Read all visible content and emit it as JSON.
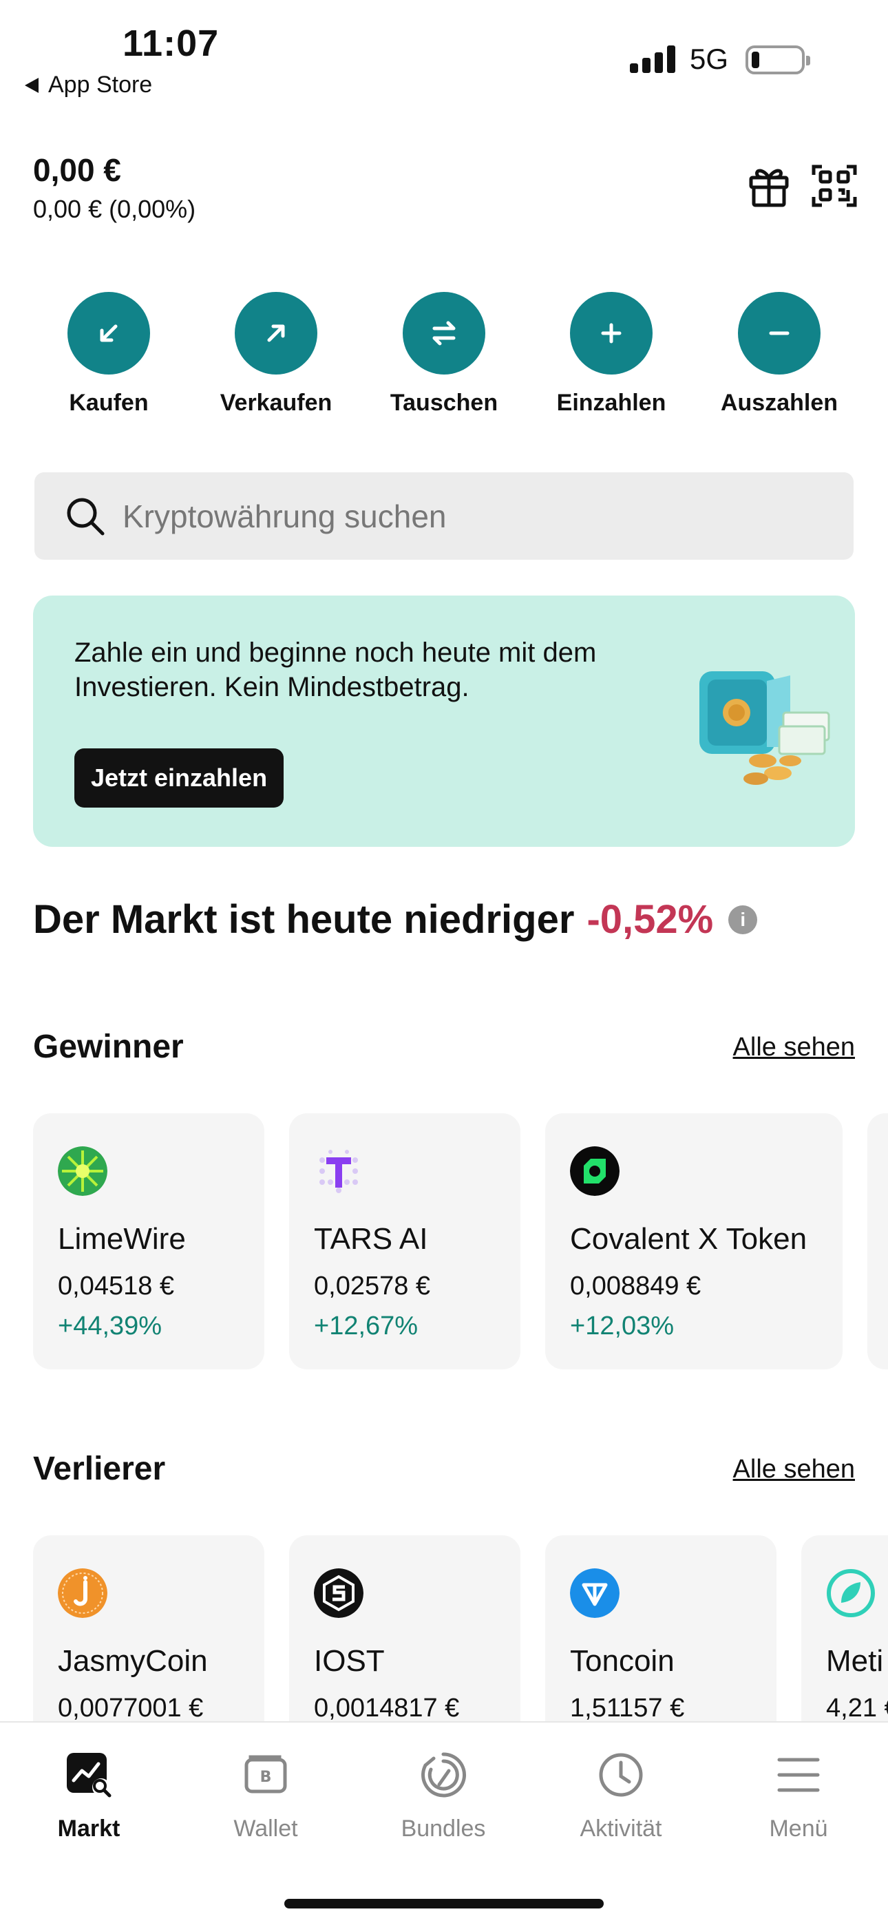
{
  "status_bar": {
    "time": "11:07",
    "back_label": "App Store",
    "network": "5G",
    "battery_level": 0.15
  },
  "portfolio": {
    "balance": "0,00 €",
    "change": "0,00 € (0,00%)"
  },
  "actions": [
    {
      "label": "Kaufen",
      "icon": "arrow-down-left-icon"
    },
    {
      "label": "Verkaufen",
      "icon": "arrow-up-right-icon"
    },
    {
      "label": "Tauschen",
      "icon": "swap-icon"
    },
    {
      "label": "Einzahlen",
      "icon": "plus-icon"
    },
    {
      "label": "Auszahlen",
      "icon": "minus-icon"
    }
  ],
  "search": {
    "placeholder": "Kryptowährung suchen"
  },
  "promo": {
    "text": "Zahle ein und beginne noch heute mit dem Investieren. Kein Mindestbetrag.",
    "button_label": "Jetzt einzahlen"
  },
  "market": {
    "headline": "Der Markt ist heute niedriger",
    "change": "-0,52%",
    "info_icon": "i"
  },
  "gainers": {
    "title": "Gewinner",
    "see_all": "Alle sehen",
    "items": [
      {
        "name": "LimeWire",
        "price": "0,04518 €",
        "change": "+44,39%"
      },
      {
        "name": "TARS AI",
        "price": "0,02578 €",
        "change": "+12,67%"
      },
      {
        "name": "Covalent X Token",
        "price": "0,008849 €",
        "change": "+12,03%"
      }
    ]
  },
  "losers": {
    "title": "Verlierer",
    "see_all": "Alle sehen",
    "items": [
      {
        "name": "JasmyCoin",
        "price": "0,0077001 €"
      },
      {
        "name": "IOST",
        "price": "0,0014817 €"
      },
      {
        "name": "Toncoin",
        "price": "1,51157 €"
      },
      {
        "name": "Meti",
        "price": "4,21 €"
      }
    ]
  },
  "tabbar": [
    {
      "label": "Markt",
      "icon": "market-chart-icon",
      "active": true
    },
    {
      "label": "Wallet",
      "icon": "wallet-icon",
      "active": false
    },
    {
      "label": "Bundles",
      "icon": "bundles-icon",
      "active": false
    },
    {
      "label": "Aktivität",
      "icon": "clock-icon",
      "active": false
    },
    {
      "label": "Menü",
      "icon": "menu-icon",
      "active": false
    }
  ],
  "colors": {
    "accent": "#118389",
    "negative": "#c33655",
    "positive": "#118373",
    "promo_bg": "#c9f0e6"
  }
}
